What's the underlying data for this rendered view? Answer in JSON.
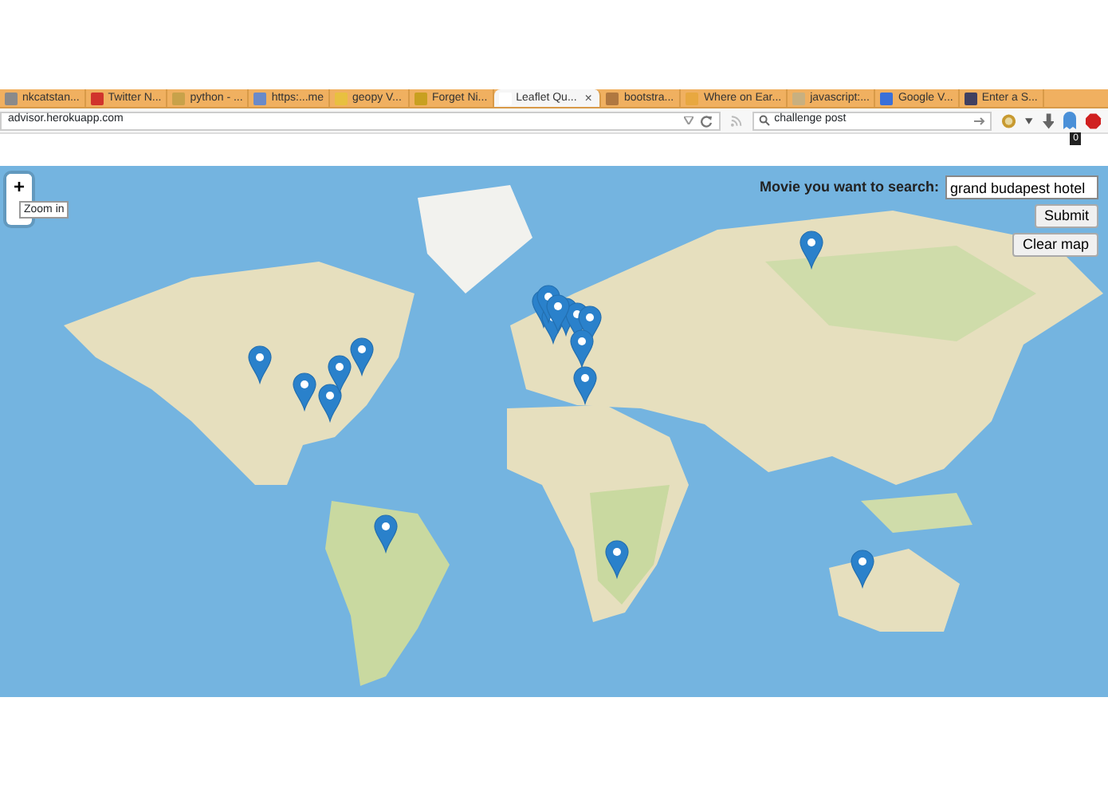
{
  "browser": {
    "tabs": [
      {
        "label": "nkcatstan...",
        "selected": false,
        "color": "#8a8a8a"
      },
      {
        "label": "Twitter N...",
        "selected": false,
        "color": "#d0342c"
      },
      {
        "label": "python - ...",
        "selected": false,
        "color": "#c8a24a"
      },
      {
        "label": "https:...me",
        "selected": false,
        "color": "#6a8ac8"
      },
      {
        "label": "geopy V...",
        "selected": false,
        "color": "#e8c040"
      },
      {
        "label": "Forget Ni...",
        "selected": false,
        "color": "#c8a020"
      },
      {
        "label": "Leaflet Qu...",
        "selected": true,
        "color": "#ffffff"
      },
      {
        "label": "bootstra...",
        "selected": false,
        "color": "#b07840"
      },
      {
        "label": "Where on Ear...",
        "selected": false,
        "color": "#e8a840"
      },
      {
        "label": "javascript:...",
        "selected": false,
        "color": "#c8b080"
      },
      {
        "label": "Google V...",
        "selected": false,
        "color": "#3a70d8"
      },
      {
        "label": "Enter a S...",
        "selected": false,
        "color": "#404060"
      }
    ],
    "tab_close": "×",
    "url": "advisor.herokuapp.com",
    "search": {
      "value": "challenge post"
    },
    "badge": "0"
  },
  "map": {
    "zoom_in": "+",
    "tooltip": "Zoom in",
    "search_form": {
      "label": "Movie you want to search:",
      "value": "grand budapest hotel",
      "buttons": [
        "Submit",
        "Clear map"
      ]
    }
  }
}
